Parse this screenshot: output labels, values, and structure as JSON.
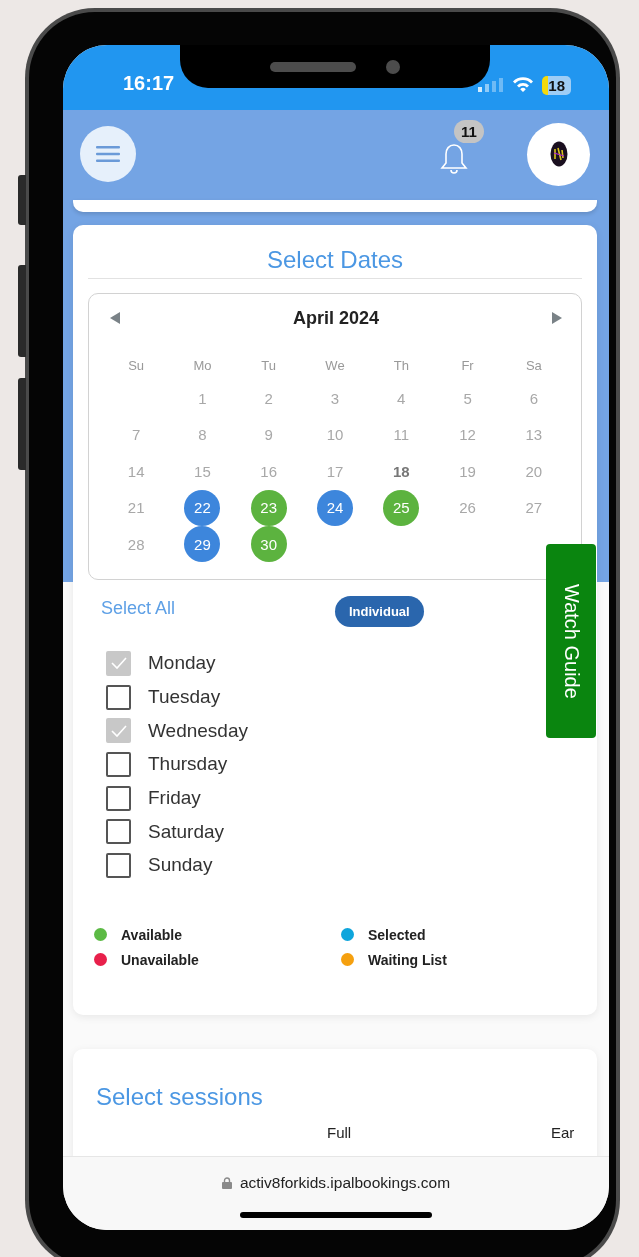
{
  "status_bar": {
    "time": "16:17",
    "battery": "18"
  },
  "header": {
    "notification_count": "11"
  },
  "select_dates": {
    "title": "Select Dates",
    "calendar": {
      "month": "April 2024",
      "weekdays": [
        "Su",
        "Mo",
        "Tu",
        "We",
        "Th",
        "Fr",
        "Sa"
      ],
      "weeks": [
        [
          {
            "kind": "blank"
          },
          {
            "day": "1",
            "kind": "inactive"
          },
          {
            "day": "2",
            "kind": "inactive"
          },
          {
            "day": "3",
            "kind": "inactive"
          },
          {
            "day": "4",
            "kind": "inactive"
          },
          {
            "day": "5",
            "kind": "inactive"
          },
          {
            "day": "6",
            "kind": "inactive"
          }
        ],
        [
          {
            "day": "7",
            "kind": "inactive"
          },
          {
            "day": "8",
            "kind": "inactive"
          },
          {
            "day": "9",
            "kind": "inactive"
          },
          {
            "day": "10",
            "kind": "inactive"
          },
          {
            "day": "11",
            "kind": "inactive"
          },
          {
            "day": "12",
            "kind": "inactive"
          },
          {
            "day": "13",
            "kind": "inactive"
          }
        ],
        [
          {
            "day": "14",
            "kind": "inactive"
          },
          {
            "day": "15",
            "kind": "inactive"
          },
          {
            "day": "16",
            "kind": "inactive"
          },
          {
            "day": "17",
            "kind": "inactive"
          },
          {
            "day": "18",
            "kind": "today"
          },
          {
            "day": "19",
            "kind": "inactive"
          },
          {
            "day": "20",
            "kind": "inactive"
          }
        ],
        [
          {
            "day": "21",
            "kind": "inactive"
          },
          {
            "day": "22",
            "kind": "selected"
          },
          {
            "day": "23",
            "kind": "available"
          },
          {
            "day": "24",
            "kind": "selected"
          },
          {
            "day": "25",
            "kind": "available"
          },
          {
            "day": "26",
            "kind": "inactive"
          },
          {
            "day": "27",
            "kind": "inactive"
          }
        ],
        [
          {
            "day": "28",
            "kind": "inactive"
          },
          {
            "day": "29",
            "kind": "selected"
          },
          {
            "day": "30",
            "kind": "available"
          }
        ]
      ]
    },
    "select_all": "Select All",
    "mode_button": "Individual",
    "weekday_filters": [
      {
        "label": "Monday",
        "checked": true
      },
      {
        "label": "Tuesday",
        "checked": false
      },
      {
        "label": "Wednesday",
        "checked": true
      },
      {
        "label": "Thursday",
        "checked": false
      },
      {
        "label": "Friday",
        "checked": false
      },
      {
        "label": "Saturday",
        "checked": false
      },
      {
        "label": "Sunday",
        "checked": false
      }
    ],
    "legend": [
      {
        "label": "Available",
        "color": "#5cba45"
      },
      {
        "label": "Selected",
        "color": "#0ea5dc"
      },
      {
        "label": "Unavailable",
        "color": "#e8204b"
      },
      {
        "label": "Waiting List",
        "color": "#f5a00f"
      }
    ]
  },
  "watch_guide": "Watch Guide",
  "select_sessions": {
    "title": "Select sessions",
    "column_headers": [
      "Full",
      "Ear"
    ]
  },
  "browser": {
    "url": "activ8forkids.ipalbookings.com"
  }
}
